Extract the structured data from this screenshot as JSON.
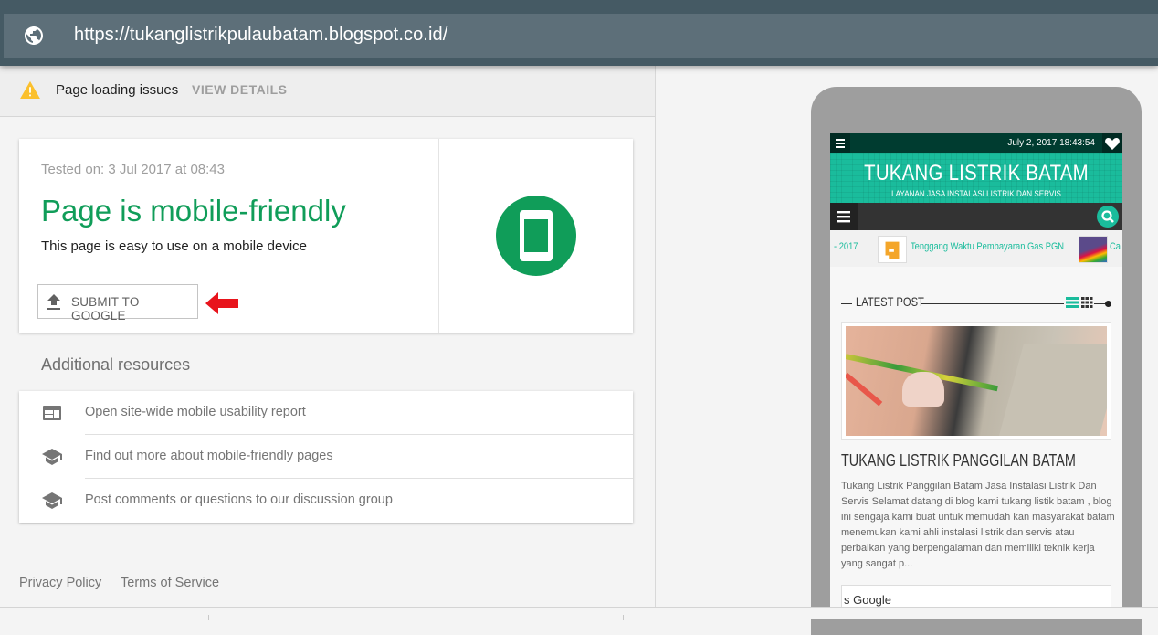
{
  "urlbar": {
    "icon": "globe-icon",
    "url": "https://tukanglistrikpulaubatam.blogspot.co.id/"
  },
  "issues": {
    "icon": "warning-icon",
    "label": "Page loading issues",
    "action": "VIEW DETAILS"
  },
  "result": {
    "tested_on": "Tested on: 3 Jul 2017 at 08:43",
    "headline": "Page is mobile-friendly",
    "subline": "This page is easy to use on a mobile device",
    "submit_label": "SUBMIT TO GOOGLE",
    "status_icon": "smartphone-icon",
    "accent_color": "#109d59"
  },
  "resources": {
    "title": "Additional resources",
    "items": [
      {
        "icon": "web-layout-icon",
        "label": "Open site-wide mobile usability report"
      },
      {
        "icon": "school-icon",
        "label": "Find out more about mobile-friendly pages"
      },
      {
        "icon": "school-icon",
        "label": "Post comments or questions to our discussion group"
      }
    ]
  },
  "footer": {
    "privacy": "Privacy Policy",
    "terms": "Terms of Service"
  },
  "preview": {
    "date": "July 2, 2017 18:43:54",
    "site_title": "TUKANG LISTRIK BATAM",
    "tagline": "LAYANAN JASA INSTALASI LISTRIK DAN SERVIS",
    "ticker": [
      {
        "text": "- 2017"
      },
      {
        "text": "Tenggang Waktu Pembayaran Gas PGN"
      },
      {
        "text": "Ca"
      }
    ],
    "section_label": "LATEST POST",
    "post_title": "TUKANG LISTRIK PANGGILAN BATAM",
    "excerpt": "Tukang Listrik Panggilan Batam Jasa Instalasi Listrik Dan Servis Selamat datang di blog kami tukang listik batam , blog ini sengaja kami buat untuk memudah kan masyarakat batam menemukan kami ahli instalasi listrik dan servis atau perbaikan yang berpengalaman dan memiliki teknik kerja yang sangat p...",
    "widget_text": "s Google",
    "theme_color": "#1abc9c"
  }
}
